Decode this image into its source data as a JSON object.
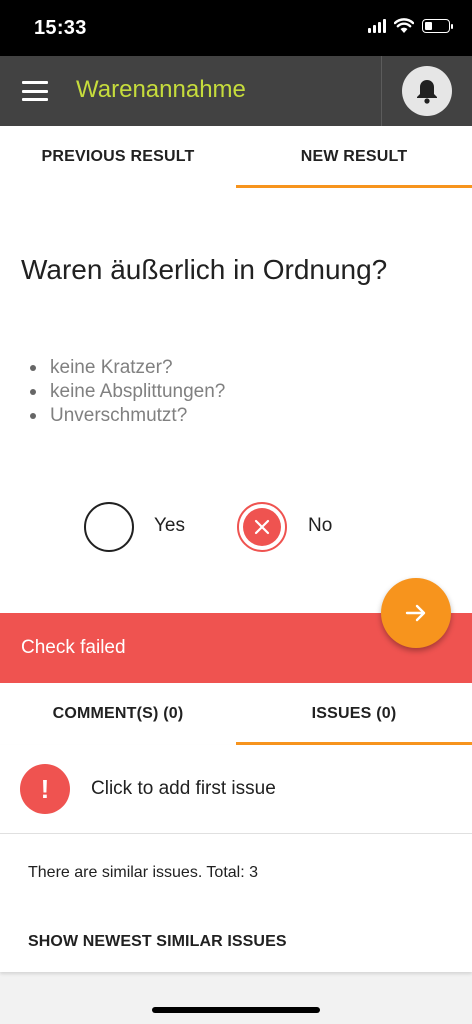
{
  "status_bar": {
    "time": "15:33",
    "battery_level": 0.3
  },
  "app_bar": {
    "title": "Warenannahme",
    "title_color": "#c6dc3c",
    "menu_icon": "hamburger-menu-icon",
    "bell_icon": "bell-icon"
  },
  "result_tabs": {
    "previous": "PREVIOUS RESULT",
    "new": "NEW RESULT",
    "active": "new"
  },
  "question": {
    "title": "Waren äußerlich in Ordnung?",
    "bullets": [
      "keine Kratzer?",
      "keine Absplittungen?",
      "Unverschmutzt?"
    ]
  },
  "answers": {
    "yes_label": "Yes",
    "no_label": "No",
    "selected": "no"
  },
  "fail_banner": {
    "text": "Check failed",
    "color": "#ef5350"
  },
  "fab": {
    "icon": "arrow-right-icon",
    "color": "#f7941d"
  },
  "issue_tabs": {
    "comments": "COMMENT(S) (0)",
    "issues": "ISSUES (0)",
    "active": "issues"
  },
  "issues": {
    "add_first": "Click to add first issue",
    "alert_glyph": "!",
    "similar_text": "There are similar issues. Total: 3",
    "show_similar": "SHOW NEWEST SIMILAR ISSUES"
  }
}
